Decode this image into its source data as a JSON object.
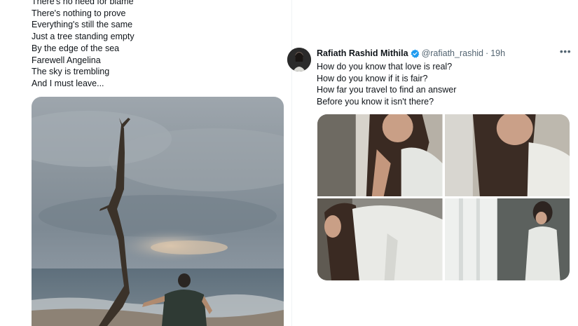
{
  "left_tweet": {
    "lines": [
      "There's no need for blame",
      "There's nothing to prove",
      "Everything's still the same",
      "Just a tree standing empty",
      "By the edge of the sea",
      "Farewell Angelina",
      "The sky is trembling",
      "And I must leave..."
    ],
    "media": {
      "description_icon": "beach-photo"
    }
  },
  "right_tweet": {
    "author": {
      "display_name": "Rafiath Rashid Mithila",
      "handle": "@rafiath_rashid",
      "separator": "·",
      "time": "19h",
      "verified_icon": "verified-badge-icon"
    },
    "more_label": "•••",
    "lines": [
      "How do you know that love is real?",
      "How do you know if it is fair?",
      "How far you travel to find an answer",
      "Before you know it isn't there?"
    ],
    "photos_count": 4
  },
  "colors": {
    "text_primary": "#0f1419",
    "text_secondary": "#536471",
    "verified_blue": "#1d9bf0",
    "divider": "#eff3f4"
  }
}
